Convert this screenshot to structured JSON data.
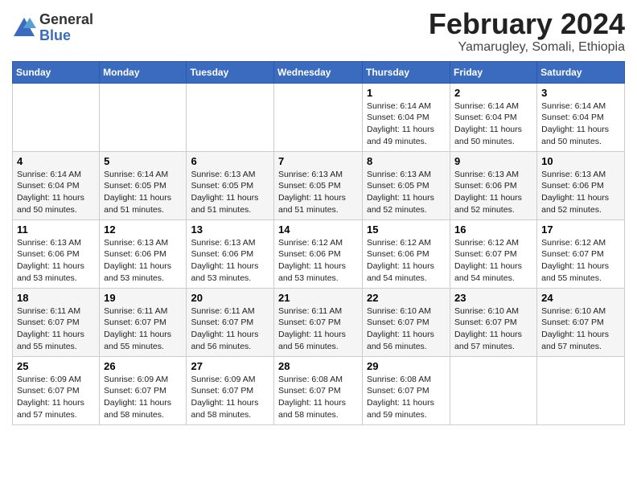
{
  "logo": {
    "general": "General",
    "blue": "Blue"
  },
  "title": {
    "month_year": "February 2024",
    "location": "Yamarugley, Somali, Ethiopia"
  },
  "headers": [
    "Sunday",
    "Monday",
    "Tuesday",
    "Wednesday",
    "Thursday",
    "Friday",
    "Saturday"
  ],
  "weeks": [
    [
      {
        "day": "",
        "info": ""
      },
      {
        "day": "",
        "info": ""
      },
      {
        "day": "",
        "info": ""
      },
      {
        "day": "",
        "info": ""
      },
      {
        "day": "1",
        "info": "Sunrise: 6:14 AM\nSunset: 6:04 PM\nDaylight: 11 hours\nand 49 minutes."
      },
      {
        "day": "2",
        "info": "Sunrise: 6:14 AM\nSunset: 6:04 PM\nDaylight: 11 hours\nand 50 minutes."
      },
      {
        "day": "3",
        "info": "Sunrise: 6:14 AM\nSunset: 6:04 PM\nDaylight: 11 hours\nand 50 minutes."
      }
    ],
    [
      {
        "day": "4",
        "info": "Sunrise: 6:14 AM\nSunset: 6:04 PM\nDaylight: 11 hours\nand 50 minutes."
      },
      {
        "day": "5",
        "info": "Sunrise: 6:14 AM\nSunset: 6:05 PM\nDaylight: 11 hours\nand 51 minutes."
      },
      {
        "day": "6",
        "info": "Sunrise: 6:13 AM\nSunset: 6:05 PM\nDaylight: 11 hours\nand 51 minutes."
      },
      {
        "day": "7",
        "info": "Sunrise: 6:13 AM\nSunset: 6:05 PM\nDaylight: 11 hours\nand 51 minutes."
      },
      {
        "day": "8",
        "info": "Sunrise: 6:13 AM\nSunset: 6:05 PM\nDaylight: 11 hours\nand 52 minutes."
      },
      {
        "day": "9",
        "info": "Sunrise: 6:13 AM\nSunset: 6:06 PM\nDaylight: 11 hours\nand 52 minutes."
      },
      {
        "day": "10",
        "info": "Sunrise: 6:13 AM\nSunset: 6:06 PM\nDaylight: 11 hours\nand 52 minutes."
      }
    ],
    [
      {
        "day": "11",
        "info": "Sunrise: 6:13 AM\nSunset: 6:06 PM\nDaylight: 11 hours\nand 53 minutes."
      },
      {
        "day": "12",
        "info": "Sunrise: 6:13 AM\nSunset: 6:06 PM\nDaylight: 11 hours\nand 53 minutes."
      },
      {
        "day": "13",
        "info": "Sunrise: 6:13 AM\nSunset: 6:06 PM\nDaylight: 11 hours\nand 53 minutes."
      },
      {
        "day": "14",
        "info": "Sunrise: 6:12 AM\nSunset: 6:06 PM\nDaylight: 11 hours\nand 53 minutes."
      },
      {
        "day": "15",
        "info": "Sunrise: 6:12 AM\nSunset: 6:06 PM\nDaylight: 11 hours\nand 54 minutes."
      },
      {
        "day": "16",
        "info": "Sunrise: 6:12 AM\nSunset: 6:07 PM\nDaylight: 11 hours\nand 54 minutes."
      },
      {
        "day": "17",
        "info": "Sunrise: 6:12 AM\nSunset: 6:07 PM\nDaylight: 11 hours\nand 55 minutes."
      }
    ],
    [
      {
        "day": "18",
        "info": "Sunrise: 6:11 AM\nSunset: 6:07 PM\nDaylight: 11 hours\nand 55 minutes."
      },
      {
        "day": "19",
        "info": "Sunrise: 6:11 AM\nSunset: 6:07 PM\nDaylight: 11 hours\nand 55 minutes."
      },
      {
        "day": "20",
        "info": "Sunrise: 6:11 AM\nSunset: 6:07 PM\nDaylight: 11 hours\nand 56 minutes."
      },
      {
        "day": "21",
        "info": "Sunrise: 6:11 AM\nSunset: 6:07 PM\nDaylight: 11 hours\nand 56 minutes."
      },
      {
        "day": "22",
        "info": "Sunrise: 6:10 AM\nSunset: 6:07 PM\nDaylight: 11 hours\nand 56 minutes."
      },
      {
        "day": "23",
        "info": "Sunrise: 6:10 AM\nSunset: 6:07 PM\nDaylight: 11 hours\nand 57 minutes."
      },
      {
        "day": "24",
        "info": "Sunrise: 6:10 AM\nSunset: 6:07 PM\nDaylight: 11 hours\nand 57 minutes."
      }
    ],
    [
      {
        "day": "25",
        "info": "Sunrise: 6:09 AM\nSunset: 6:07 PM\nDaylight: 11 hours\nand 57 minutes."
      },
      {
        "day": "26",
        "info": "Sunrise: 6:09 AM\nSunset: 6:07 PM\nDaylight: 11 hours\nand 58 minutes."
      },
      {
        "day": "27",
        "info": "Sunrise: 6:09 AM\nSunset: 6:07 PM\nDaylight: 11 hours\nand 58 minutes."
      },
      {
        "day": "28",
        "info": "Sunrise: 6:08 AM\nSunset: 6:07 PM\nDaylight: 11 hours\nand 58 minutes."
      },
      {
        "day": "29",
        "info": "Sunrise: 6:08 AM\nSunset: 6:07 PM\nDaylight: 11 hours\nand 59 minutes."
      },
      {
        "day": "",
        "info": ""
      },
      {
        "day": "",
        "info": ""
      }
    ]
  ]
}
